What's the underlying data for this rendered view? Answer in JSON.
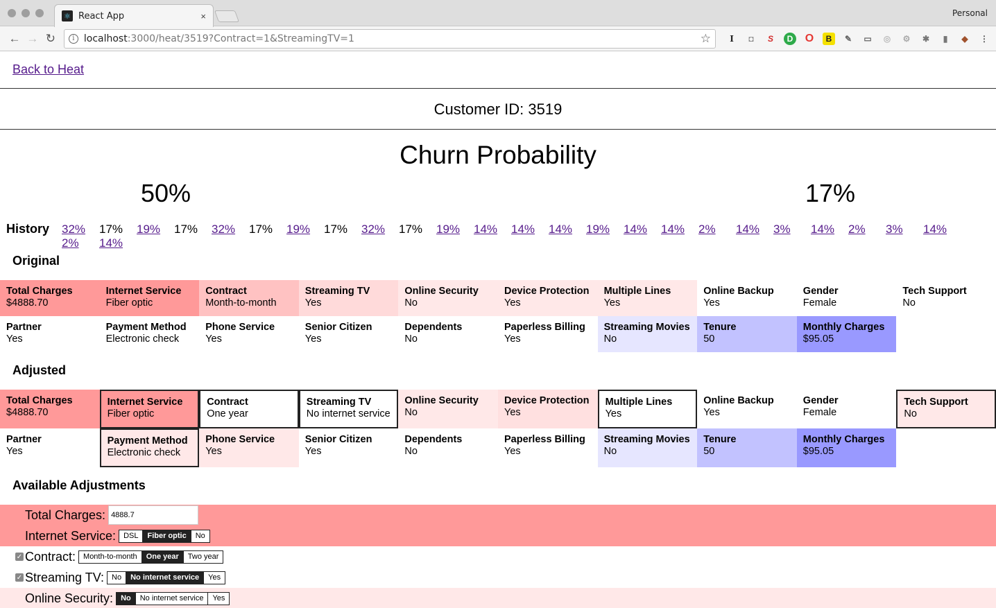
{
  "browser": {
    "tab_title": "React App",
    "tab_close": "×",
    "profile": "Personal",
    "url_host": "localhost",
    "url_rest": ":3000/heat/3519?Contract=1&StreamingTV=1"
  },
  "page": {
    "back_link": "Back to Heat",
    "customer": "Customer ID: 3519",
    "churn_title": "Churn Probability",
    "prob_original": "50%",
    "prob_adjusted": "17%",
    "history_label": "History",
    "history": [
      {
        "v": "32%",
        "link": true
      },
      {
        "v": "17%",
        "link": false
      },
      {
        "v": "19%",
        "link": true
      },
      {
        "v": "17%",
        "link": false
      },
      {
        "v": "32%",
        "link": true
      },
      {
        "v": "17%",
        "link": false
      },
      {
        "v": "19%",
        "link": true
      },
      {
        "v": "17%",
        "link": false
      },
      {
        "v": "32%",
        "link": true
      },
      {
        "v": "17%",
        "link": false
      },
      {
        "v": "19%",
        "link": true
      },
      {
        "v": "14%",
        "link": true
      },
      {
        "v": "14%",
        "link": true
      },
      {
        "v": "14%",
        "link": true
      },
      {
        "v": "19%",
        "link": true
      },
      {
        "v": "14%",
        "link": true
      },
      {
        "v": "14%",
        "link": true
      },
      {
        "v": "2%",
        "link": true
      },
      {
        "v": "14%",
        "link": true
      },
      {
        "v": "3%",
        "link": true
      },
      {
        "v": "14%",
        "link": true
      },
      {
        "v": "2%",
        "link": true
      },
      {
        "v": "3%",
        "link": true
      },
      {
        "v": "14%",
        "link": true
      },
      {
        "v": "2%",
        "link": true
      },
      {
        "v": "14%",
        "link": true
      }
    ],
    "original_title": "Original",
    "adjusted_title": "Adjusted",
    "available_title": "Available Adjustments"
  },
  "original": [
    {
      "label": "Total Charges",
      "value": "$4888.70",
      "color": "#ff9999"
    },
    {
      "label": "Internet Service",
      "value": "Fiber optic",
      "color": "#ff9999"
    },
    {
      "label": "Contract",
      "value": "Month-to-month",
      "color": "#ffc2c2"
    },
    {
      "label": "Streaming TV",
      "value": "Yes",
      "color": "#ffdada"
    },
    {
      "label": "Online Security",
      "value": "No",
      "color": "#ffe8e8"
    },
    {
      "label": "Device Protection",
      "value": "Yes",
      "color": "#ffe8e8"
    },
    {
      "label": "Multiple Lines",
      "value": "Yes",
      "color": "#ffe8e8"
    },
    {
      "label": "Online Backup",
      "value": "Yes",
      "color": "#ffffff"
    },
    {
      "label": "Gender",
      "value": "Female",
      "color": "#ffffff"
    },
    {
      "label": "Tech Support",
      "value": "No",
      "color": "#ffffff"
    },
    {
      "label": "Partner",
      "value": "Yes",
      "color": "#ffffff"
    },
    {
      "label": "Payment Method",
      "value": "Electronic check",
      "color": "#ffffff"
    },
    {
      "label": "Phone Service",
      "value": "Yes",
      "color": "#ffffff"
    },
    {
      "label": "Senior Citizen",
      "value": "Yes",
      "color": "#ffffff"
    },
    {
      "label": "Dependents",
      "value": "No",
      "color": "#ffffff"
    },
    {
      "label": "Paperless Billing",
      "value": "Yes",
      "color": "#ffffff"
    },
    {
      "label": "Streaming Movies",
      "value": "No",
      "color": "#e6e6ff"
    },
    {
      "label": "Tenure",
      "value": "50",
      "color": "#c2c2ff"
    },
    {
      "label": "Monthly Charges",
      "value": "$95.05",
      "color": "#9999ff"
    }
  ],
  "adjusted": [
    {
      "label": "Total Charges",
      "value": "$4888.70",
      "color": "#ff9999",
      "boxed": false
    },
    {
      "label": "Internet Service",
      "value": "Fiber optic",
      "color": "#ff9999",
      "boxed": true
    },
    {
      "label": "Contract",
      "value": "One year",
      "color": "#ffffff",
      "boxed": true
    },
    {
      "label": "Streaming TV",
      "value": "No internet service",
      "color": "#ffffff",
      "boxed": true
    },
    {
      "label": "Online Security",
      "value": "No",
      "color": "#ffe8e8",
      "boxed": false
    },
    {
      "label": "Device Protection",
      "value": "Yes",
      "color": "#ffe0e0",
      "boxed": false
    },
    {
      "label": "Multiple Lines",
      "value": "Yes",
      "color": "#ffffff",
      "boxed": true
    },
    {
      "label": "Online Backup",
      "value": "Yes",
      "color": "#ffffff",
      "boxed": false
    },
    {
      "label": "Gender",
      "value": "Female",
      "color": "#ffffff",
      "boxed": false
    },
    {
      "label": "Tech Support",
      "value": "No",
      "color": "#ffe8e8",
      "boxed": true
    },
    {
      "label": "Partner",
      "value": "Yes",
      "color": "#ffffff",
      "boxed": false
    },
    {
      "label": "Payment Method",
      "value": "Electronic check",
      "color": "#ffe8e8",
      "boxed": true
    },
    {
      "label": "Phone Service",
      "value": "Yes",
      "color": "#ffe8e8",
      "boxed": false
    },
    {
      "label": "Senior Citizen",
      "value": "Yes",
      "color": "#ffffff",
      "boxed": false
    },
    {
      "label": "Dependents",
      "value": "No",
      "color": "#ffffff",
      "boxed": false
    },
    {
      "label": "Paperless Billing",
      "value": "Yes",
      "color": "#ffffff",
      "boxed": false
    },
    {
      "label": "Streaming Movies",
      "value": "No",
      "color": "#e6e6ff",
      "boxed": false
    },
    {
      "label": "Tenure",
      "value": "50",
      "color": "#c2c2ff",
      "boxed": false
    },
    {
      "label": "Monthly Charges",
      "value": "$95.05",
      "color": "#9999ff",
      "boxed": false
    }
  ],
  "adjustments": [
    {
      "label": "Total Charges:",
      "type": "input",
      "value": "4888.7",
      "checked": null,
      "color": "#ff9999"
    },
    {
      "label": "Internet Service:",
      "type": "seg",
      "options": [
        "DSL",
        "Fiber optic",
        "No"
      ],
      "selected": 1,
      "checked": null,
      "color": "#ff9999"
    },
    {
      "label": "Contract:",
      "type": "seg",
      "options": [
        "Month-to-month",
        "One year",
        "Two year"
      ],
      "selected": 1,
      "checked": true,
      "color": "#ffffff"
    },
    {
      "label": "Streaming TV:",
      "type": "seg",
      "options": [
        "No",
        "No internet service",
        "Yes"
      ],
      "selected": 1,
      "checked": true,
      "color": "#ffffff"
    },
    {
      "label": "Online Security:",
      "type": "seg",
      "options": [
        "No",
        "No internet service",
        "Yes"
      ],
      "selected": 0,
      "checked": null,
      "color": "#ffe8e8"
    }
  ]
}
